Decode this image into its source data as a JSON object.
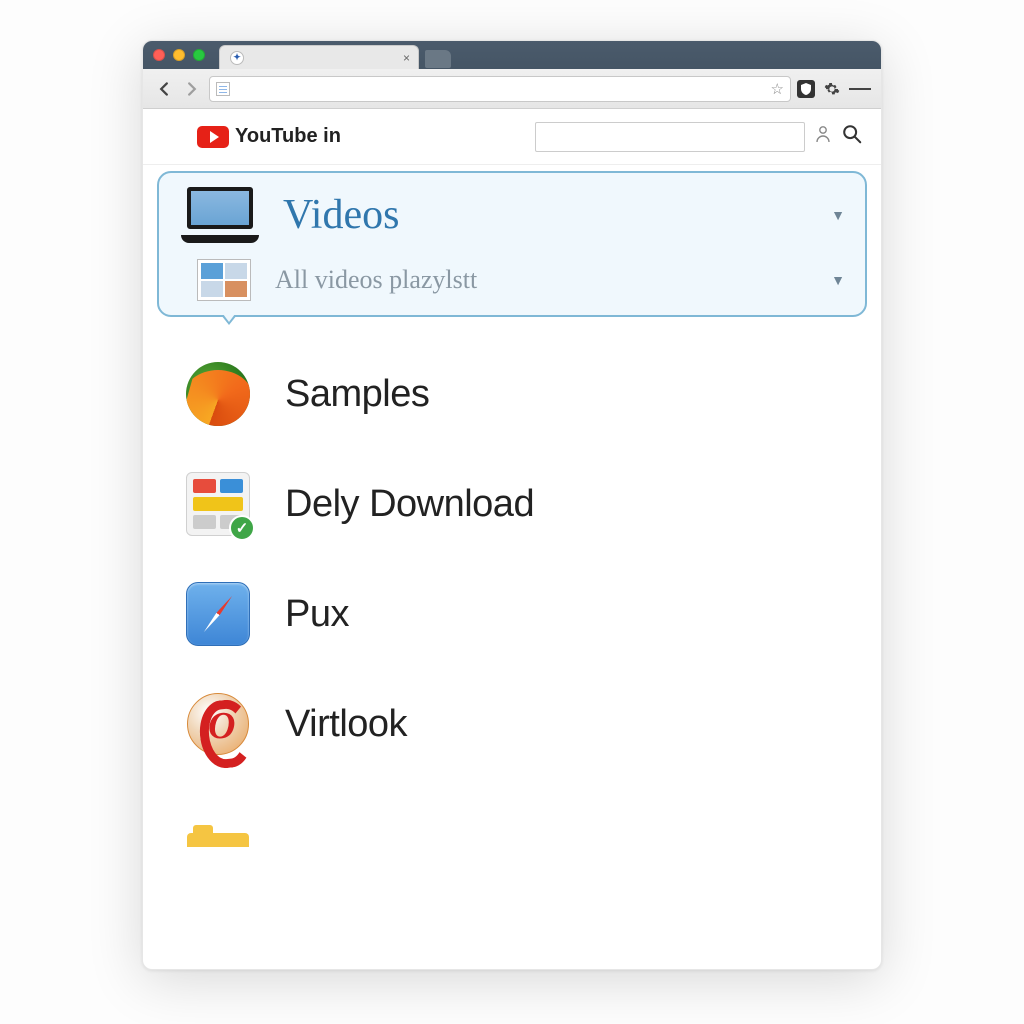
{
  "header": {
    "brand_text": "YouTube in",
    "search_placeholder": ""
  },
  "dropdown": {
    "primary_label": "Videos",
    "secondary_label": "All videos plazylstt"
  },
  "items": [
    {
      "label": "Samples",
      "icon": "firefox"
    },
    {
      "label": "Dely Download",
      "icon": "tiles-check"
    },
    {
      "label": "Pux",
      "icon": "safari"
    },
    {
      "label": "Virtlook",
      "icon": "opera"
    }
  ]
}
